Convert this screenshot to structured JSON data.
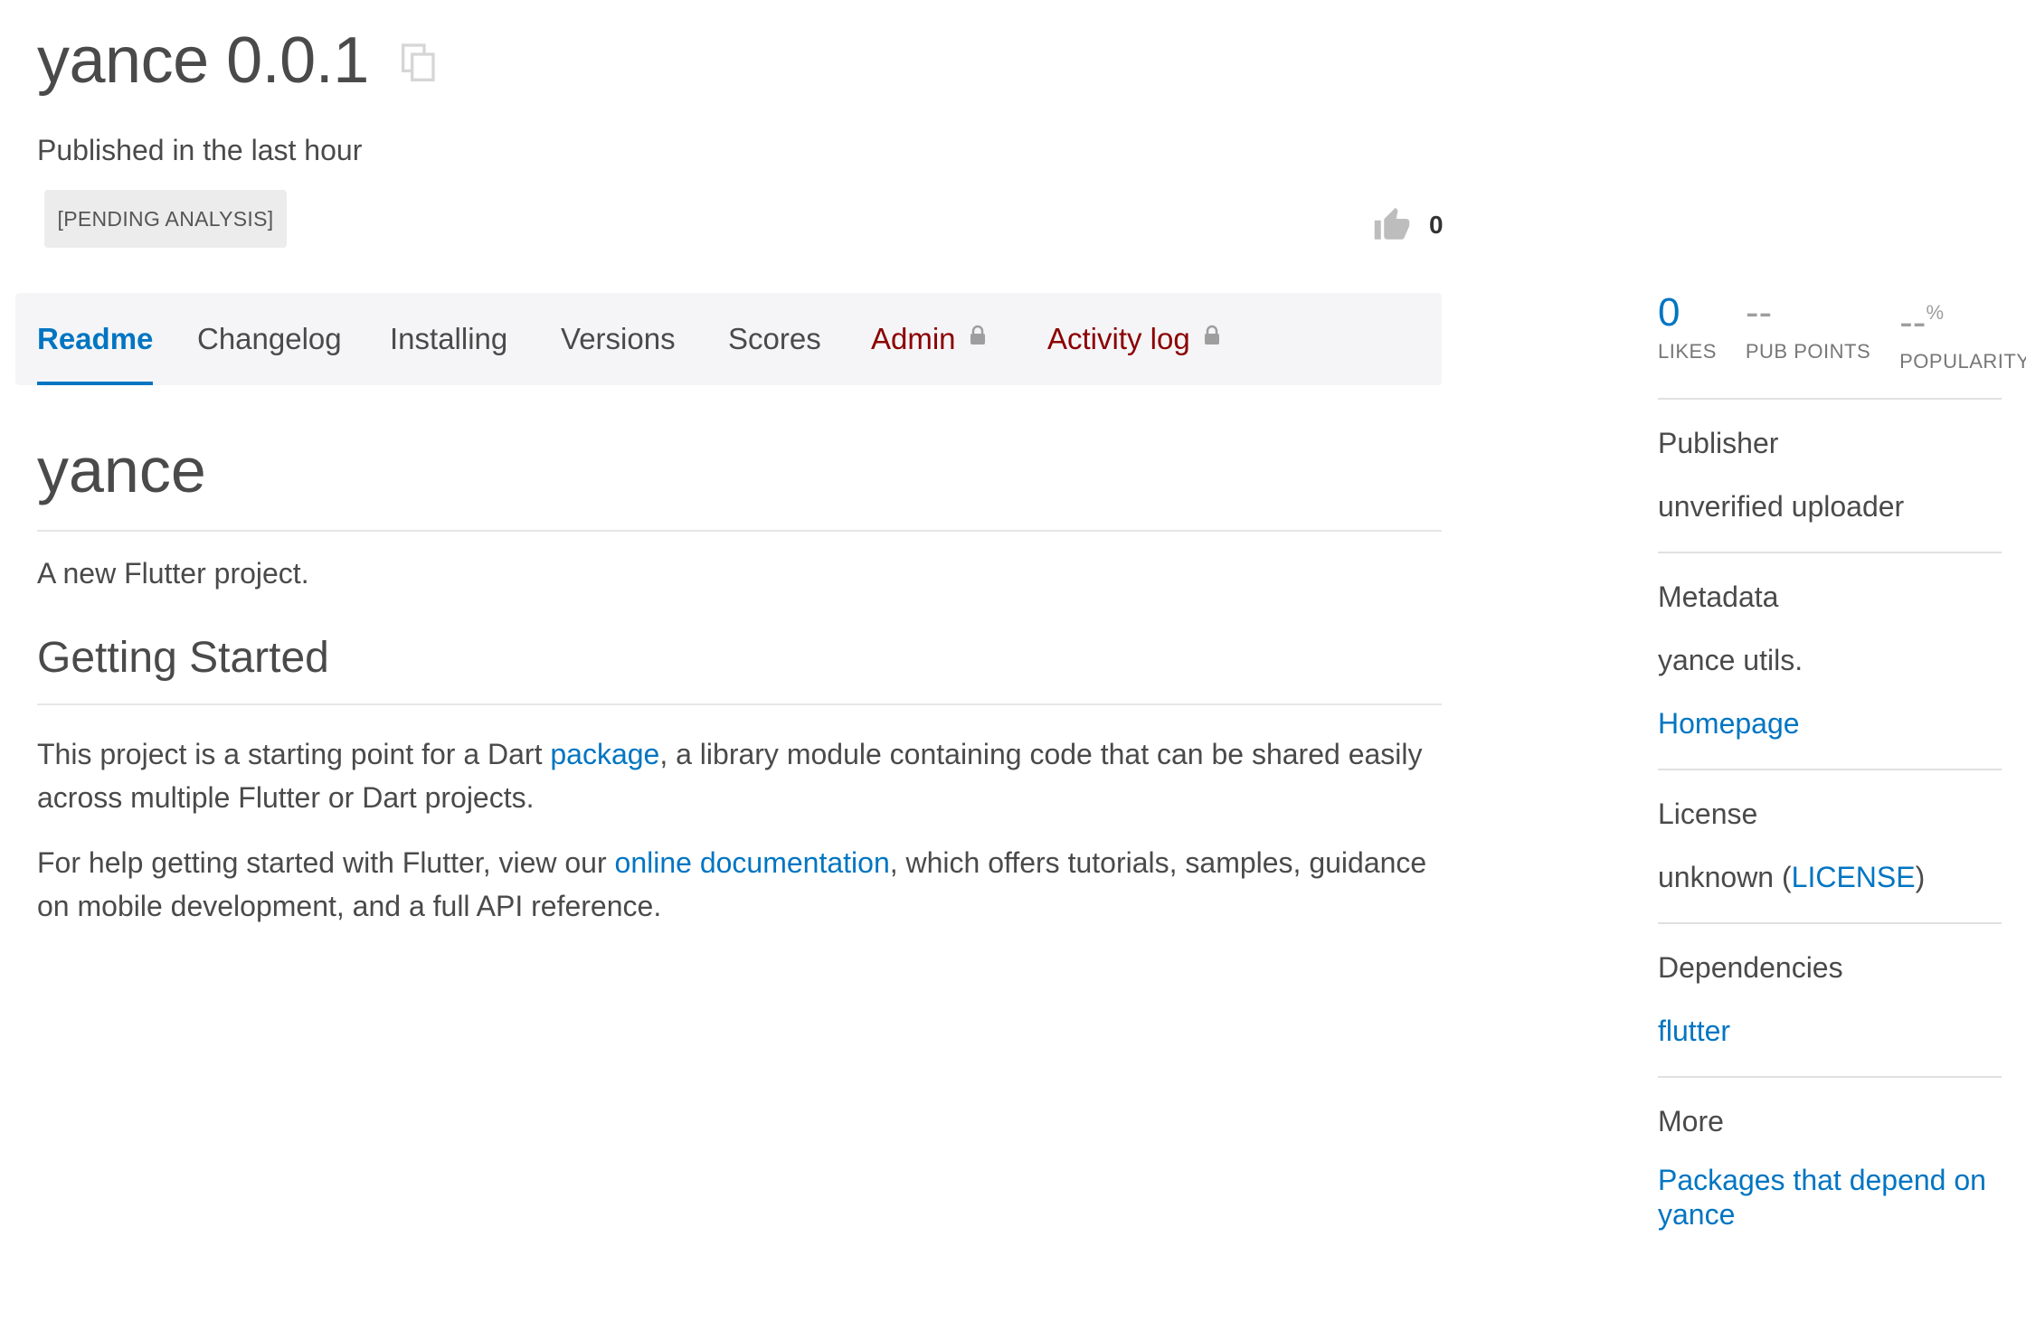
{
  "header": {
    "title": "yance 0.0.1",
    "published": "Published in the last hour",
    "badge": "[PENDING ANALYSIS]",
    "like_count": "0"
  },
  "tabs": [
    {
      "label": "Readme"
    },
    {
      "label": "Changelog"
    },
    {
      "label": "Installing"
    },
    {
      "label": "Versions"
    },
    {
      "label": "Scores"
    },
    {
      "label": "Admin"
    },
    {
      "label": "Activity log"
    }
  ],
  "readme": {
    "h1": "yance",
    "intro": "A new Flutter project.",
    "h2": "Getting Started",
    "p2_before": "This project is a starting point for a Dart ",
    "p2_link": "package",
    "p2_after": ", a library module containing code that can be shared easily across multiple Flutter or Dart projects.",
    "p3_before": "For help getting started with Flutter, view our ",
    "p3_link": "online documentation",
    "p3_after": ", which offers tutorials, samples, guidance on mobile development, and a full API reference."
  },
  "sidebar": {
    "stats": [
      {
        "value": "0",
        "label": "LIKES"
      },
      {
        "value": "--",
        "label": "PUB POINTS"
      },
      {
        "value": "--",
        "suffix": "%",
        "label": "POPULARITY"
      }
    ],
    "publisher_title": "Publisher",
    "publisher_value": "unverified uploader",
    "metadata_title": "Metadata",
    "metadata_desc": "yance utils.",
    "homepage_link": "Homepage",
    "license_title": "License",
    "license_prefix": "unknown (",
    "license_link": "LICENSE",
    "license_suffix": ")",
    "dependencies_title": "Dependencies",
    "dependency": "flutter",
    "more_title": "More",
    "more_link": "Packages that depend on yance"
  },
  "colors": {
    "accent": "#0175c2",
    "admin": "#8b0000",
    "tab_bg": "#f5f5f7"
  }
}
